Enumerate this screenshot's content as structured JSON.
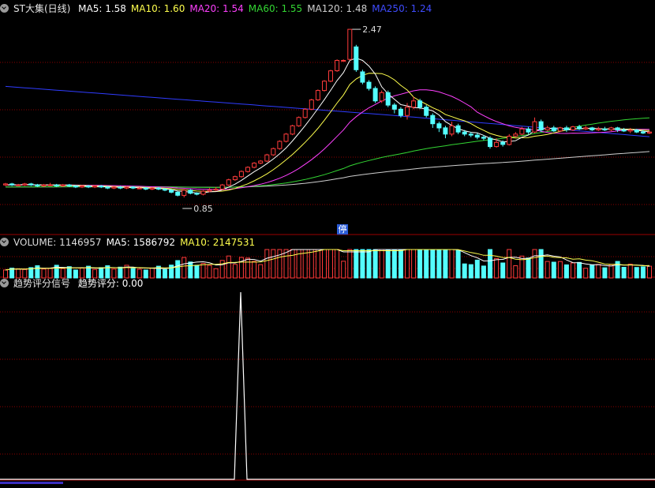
{
  "colors": {
    "up": "#ff3b3b",
    "down": "#54ffff",
    "ma5": "#ffffff",
    "ma10": "#ffff4d",
    "ma20": "#ff40ff",
    "ma60": "#33d633",
    "ma120": "#cfcfcf",
    "ma250": "#2f3cff",
    "grid": "#8b0000",
    "panel_border": "#9b0000"
  },
  "price_header": {
    "title": "ST大集(日线)",
    "items": [
      {
        "label": "MA5: 1.58",
        "color": "#ffffff"
      },
      {
        "label": "MA10: 1.60",
        "color": "#ffff4d"
      },
      {
        "label": "MA20: 1.54",
        "color": "#ff40ff"
      },
      {
        "label": "MA60: 1.55",
        "color": "#33d633"
      },
      {
        "label": "MA120: 1.48",
        "color": "#cfcfcf"
      },
      {
        "label": "MA250: 1.24",
        "color": "#3f4cff"
      }
    ]
  },
  "volume_header": {
    "items": [
      {
        "label": "VOLUME: 1146957",
        "color": "#dddddd"
      },
      {
        "label": "MA5: 1586792",
        "color": "#ffffff"
      },
      {
        "label": "MA10: 2147531",
        "color": "#ffff4d"
      }
    ]
  },
  "signal_header": {
    "title": "趋势评分信号",
    "items": [
      {
        "label": "趋势评分: 0.00",
        "color": "#ffffff"
      }
    ]
  },
  "stop_badge": "停",
  "chart_data": [
    {
      "type": "candlestick",
      "panel": "price",
      "ylim": [
        0.5,
        2.6
      ],
      "annotations": [
        {
          "text": "2.47",
          "value": 2.47
        },
        {
          "text": "0.85",
          "value": 0.85
        }
      ],
      "candles": [
        [
          0.97,
          0.98,
          0.99,
          0.96
        ],
        [
          0.98,
          0.97,
          0.99,
          0.96
        ],
        [
          0.97,
          0.97,
          0.98,
          0.96
        ],
        [
          0.97,
          0.98,
          0.99,
          0.96
        ],
        [
          0.98,
          0.97,
          0.99,
          0.96
        ],
        [
          0.97,
          0.96,
          0.98,
          0.95
        ],
        [
          0.96,
          0.97,
          0.98,
          0.95
        ],
        [
          0.97,
          0.97,
          0.99,
          0.96
        ],
        [
          0.97,
          0.96,
          0.98,
          0.95
        ],
        [
          0.96,
          0.97,
          0.98,
          0.95
        ],
        [
          0.97,
          0.96,
          0.98,
          0.95
        ],
        [
          0.96,
          0.95,
          0.97,
          0.94
        ],
        [
          0.95,
          0.96,
          0.97,
          0.94
        ],
        [
          0.96,
          0.95,
          0.97,
          0.94
        ],
        [
          0.95,
          0.96,
          0.97,
          0.94
        ],
        [
          0.96,
          0.95,
          0.97,
          0.94
        ],
        [
          0.95,
          0.94,
          0.96,
          0.93
        ],
        [
          0.94,
          0.95,
          0.96,
          0.93
        ],
        [
          0.95,
          0.94,
          0.96,
          0.93
        ],
        [
          0.94,
          0.95,
          0.96,
          0.93
        ],
        [
          0.95,
          0.94,
          0.96,
          0.93
        ],
        [
          0.94,
          0.94,
          0.95,
          0.93
        ],
        [
          0.94,
          0.93,
          0.95,
          0.92
        ],
        [
          0.93,
          0.94,
          0.95,
          0.92
        ],
        [
          0.94,
          0.93,
          0.95,
          0.92
        ],
        [
          0.93,
          0.92,
          0.94,
          0.91
        ],
        [
          0.92,
          0.9,
          0.93,
          0.89
        ],
        [
          0.9,
          0.87,
          0.91,
          0.86
        ],
        [
          0.87,
          0.92,
          0.93,
          0.85
        ],
        [
          0.92,
          0.89,
          0.93,
          0.88
        ],
        [
          0.89,
          0.88,
          0.9,
          0.87
        ],
        [
          0.88,
          0.91,
          0.92,
          0.87
        ],
        [
          0.91,
          0.92,
          0.94,
          0.9
        ],
        [
          0.92,
          0.93,
          0.95,
          0.91
        ],
        [
          0.93,
          0.97,
          0.98,
          0.92
        ],
        [
          0.97,
          1.02,
          1.03,
          0.96
        ],
        [
          1.02,
          1.05,
          1.06,
          1.01
        ],
        [
          1.05,
          1.1,
          1.11,
          1.04
        ],
        [
          1.1,
          1.14,
          1.15,
          1.09
        ],
        [
          1.14,
          1.18,
          1.19,
          1.13
        ],
        [
          1.18,
          1.2,
          1.21,
          1.17
        ],
        [
          1.2,
          1.26,
          1.27,
          1.19
        ],
        [
          1.26,
          1.32,
          1.33,
          1.25
        ],
        [
          1.32,
          1.39,
          1.4,
          1.31
        ],
        [
          1.39,
          1.46,
          1.47,
          1.38
        ],
        [
          1.46,
          1.54,
          1.55,
          1.45
        ],
        [
          1.54,
          1.62,
          1.63,
          1.53
        ],
        [
          1.62,
          1.7,
          1.71,
          1.61
        ],
        [
          1.7,
          1.79,
          1.8,
          1.69
        ],
        [
          1.79,
          1.88,
          1.89,
          1.78
        ],
        [
          1.88,
          1.97,
          1.98,
          1.87
        ],
        [
          1.97,
          2.07,
          2.08,
          1.96
        ],
        [
          2.07,
          2.17,
          2.18,
          2.06
        ],
        [
          2.17,
          2.17,
          2.18,
          2.16
        ],
        [
          2.18,
          2.47,
          2.47,
          2.17
        ],
        [
          2.3,
          2.08,
          2.32,
          2.06
        ],
        [
          2.06,
          1.96,
          2.08,
          1.94
        ],
        [
          1.96,
          1.9,
          1.98,
          1.88
        ],
        [
          1.9,
          1.78,
          1.92,
          1.76
        ],
        [
          1.78,
          1.86,
          1.88,
          1.76
        ],
        [
          1.86,
          1.74,
          1.88,
          1.72
        ],
        [
          1.74,
          1.7,
          1.76,
          1.66
        ],
        [
          1.7,
          1.64,
          1.72,
          1.62
        ],
        [
          1.64,
          1.72,
          1.76,
          1.6
        ],
        [
          1.72,
          1.78,
          1.82,
          1.7
        ],
        [
          1.78,
          1.72,
          1.8,
          1.7
        ],
        [
          1.72,
          1.64,
          1.74,
          1.62
        ],
        [
          1.64,
          1.56,
          1.66,
          1.52
        ],
        [
          1.56,
          1.52,
          1.58,
          1.48
        ],
        [
          1.52,
          1.46,
          1.54,
          1.42
        ],
        [
          1.46,
          1.54,
          1.58,
          1.44
        ],
        [
          1.54,
          1.48,
          1.56,
          1.46
        ],
        [
          1.48,
          1.46,
          1.5,
          1.44
        ],
        [
          1.46,
          1.45,
          1.48,
          1.43
        ],
        [
          1.45,
          1.43,
          1.47,
          1.41
        ],
        [
          1.43,
          1.42,
          1.45,
          1.4
        ],
        [
          1.42,
          1.34,
          1.44,
          1.32
        ],
        [
          1.34,
          1.38,
          1.42,
          1.33
        ],
        [
          1.38,
          1.36,
          1.4,
          1.34
        ],
        [
          1.36,
          1.44,
          1.46,
          1.35
        ],
        [
          1.44,
          1.46,
          1.48,
          1.43
        ],
        [
          1.46,
          1.51,
          1.53,
          1.45
        ],
        [
          1.51,
          1.48,
          1.53,
          1.46
        ],
        [
          1.48,
          1.58,
          1.62,
          1.47
        ],
        [
          1.58,
          1.5,
          1.6,
          1.48
        ],
        [
          1.5,
          1.52,
          1.54,
          1.49
        ],
        [
          1.52,
          1.49,
          1.54,
          1.48
        ],
        [
          1.49,
          1.52,
          1.53,
          1.48
        ],
        [
          1.52,
          1.5,
          1.54,
          1.48
        ],
        [
          1.5,
          1.53,
          1.54,
          1.49
        ],
        [
          1.53,
          1.51,
          1.55,
          1.5
        ],
        [
          1.51,
          1.52,
          1.54,
          1.5
        ],
        [
          1.52,
          1.5,
          1.53,
          1.49
        ],
        [
          1.5,
          1.51,
          1.53,
          1.49
        ],
        [
          1.51,
          1.5,
          1.53,
          1.49
        ],
        [
          1.5,
          1.52,
          1.53,
          1.49
        ],
        [
          1.52,
          1.5,
          1.53,
          1.48
        ],
        [
          1.5,
          1.49,
          1.52,
          1.48
        ],
        [
          1.49,
          1.5,
          1.52,
          1.47
        ],
        [
          1.5,
          1.48,
          1.51,
          1.47
        ],
        [
          1.48,
          1.47,
          1.5,
          1.46
        ],
        [
          1.47,
          1.48,
          1.49,
          1.46
        ]
      ]
    },
    {
      "type": "bar",
      "panel": "volume",
      "ylim": [
        0,
        9000000
      ]
    },
    {
      "type": "line",
      "panel": "signal",
      "ylim": [
        0,
        1
      ]
    }
  ]
}
